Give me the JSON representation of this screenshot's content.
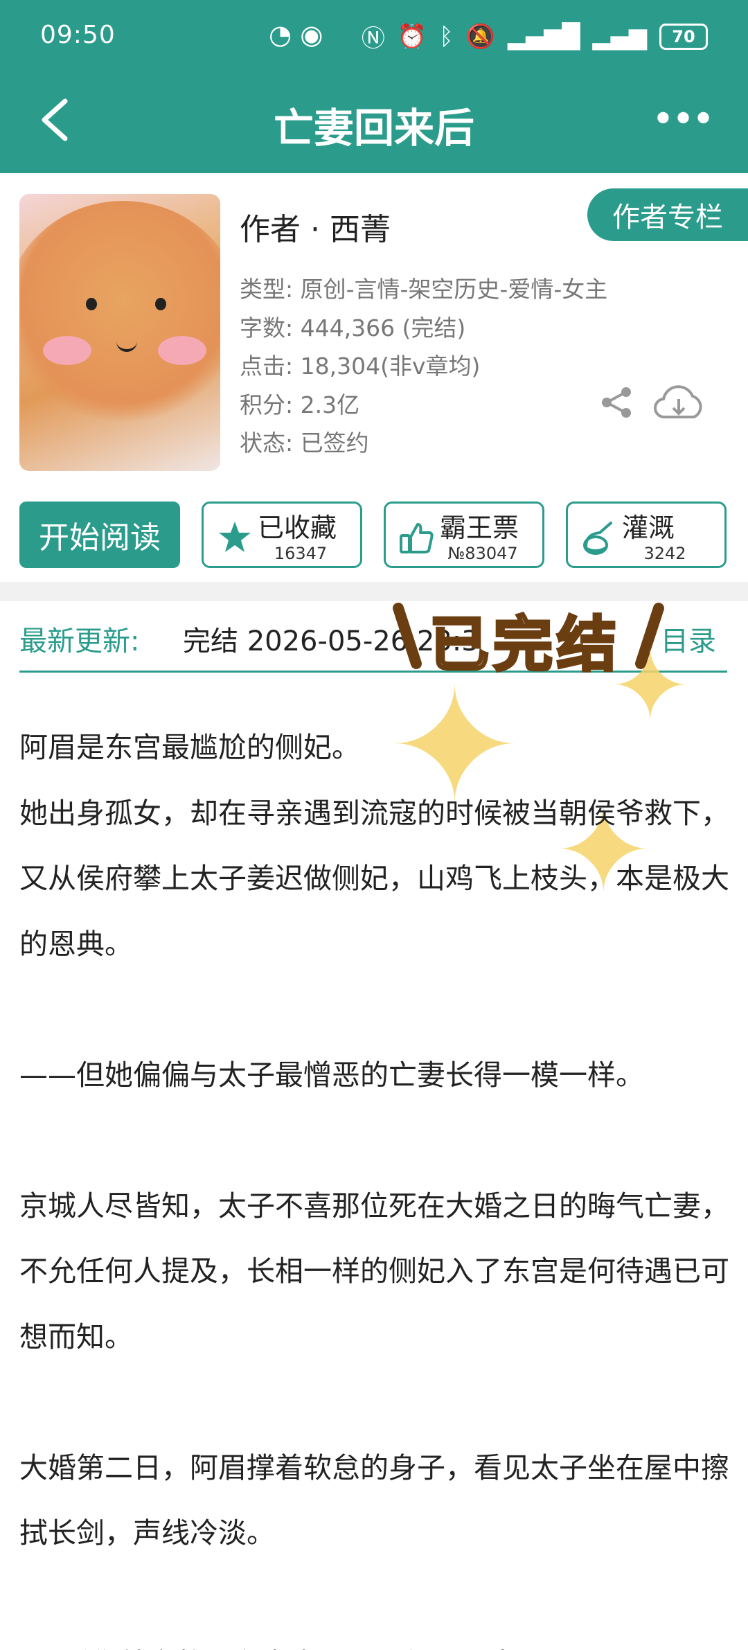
{
  "status_bar": {
    "time": "09:50",
    "battery": "70",
    "icons": [
      "speed-icon",
      "eye-icon",
      "nfc-icon",
      "alarm-icon",
      "bluetooth-icon",
      "mute-icon",
      "signal-4g-icon",
      "signal-4g-icon"
    ]
  },
  "nav": {
    "title": "亡妻回来后",
    "back_icon": "back-chevron-icon",
    "more_icon": "more-icon"
  },
  "book": {
    "author_line": "作者 · 西菁",
    "author_column_label": "作者专栏",
    "genre": "类型: 原创-言情-架空历史-爱情-女主",
    "word_count": "字数: 444,366 (完结)",
    "clicks": "点击: 18,304(非v章均)",
    "points": "积分: 2.3亿",
    "status": "状态: 已签约"
  },
  "actions": {
    "read_label": "开始阅读",
    "collect_label": "已收藏",
    "collect_count": "16347",
    "vote_label": "霸王票",
    "vote_rank": "№83047",
    "irrigate_label": "灌溉",
    "irrigate_count": "3242"
  },
  "latest": {
    "label": "最新更新:",
    "chapter": "完结 2026-05-26 23:3",
    "toc_label": "目录"
  },
  "sticker": {
    "text": "已完结"
  },
  "synopsis": [
    "阿眉是东宫最尴尬的侧妃。",
    "她出身孤女，却在寻亲遇到流寇的时候被当朝侯爷救下，又从侯府攀上太子姜迟做侧妃，山鸡飞上枝头，本是极大的恩典。",
    "",
    "——但她偏偏与太子最憎恶的亡妻长得一模一样。",
    "",
    "京城人尽皆知，太子不喜那位死在大婚之日的晦气亡妻，不允任何人提及，长相一样的侧妃入了东宫是何待遇已可想而知。",
    "",
    "大婚第二日，阿眉撑着软怠的身子，看见太子坐在屋中擦拭长剑，声线冷淡。",
    "",
    "“日后你就安静呆在宫中，哪里都不要去。”"
  ],
  "colors": {
    "accent": "#2b9c8c",
    "meta_text": "#777777",
    "sticker_outline": "#6b3e12",
    "sparkle": "#f6d469"
  }
}
